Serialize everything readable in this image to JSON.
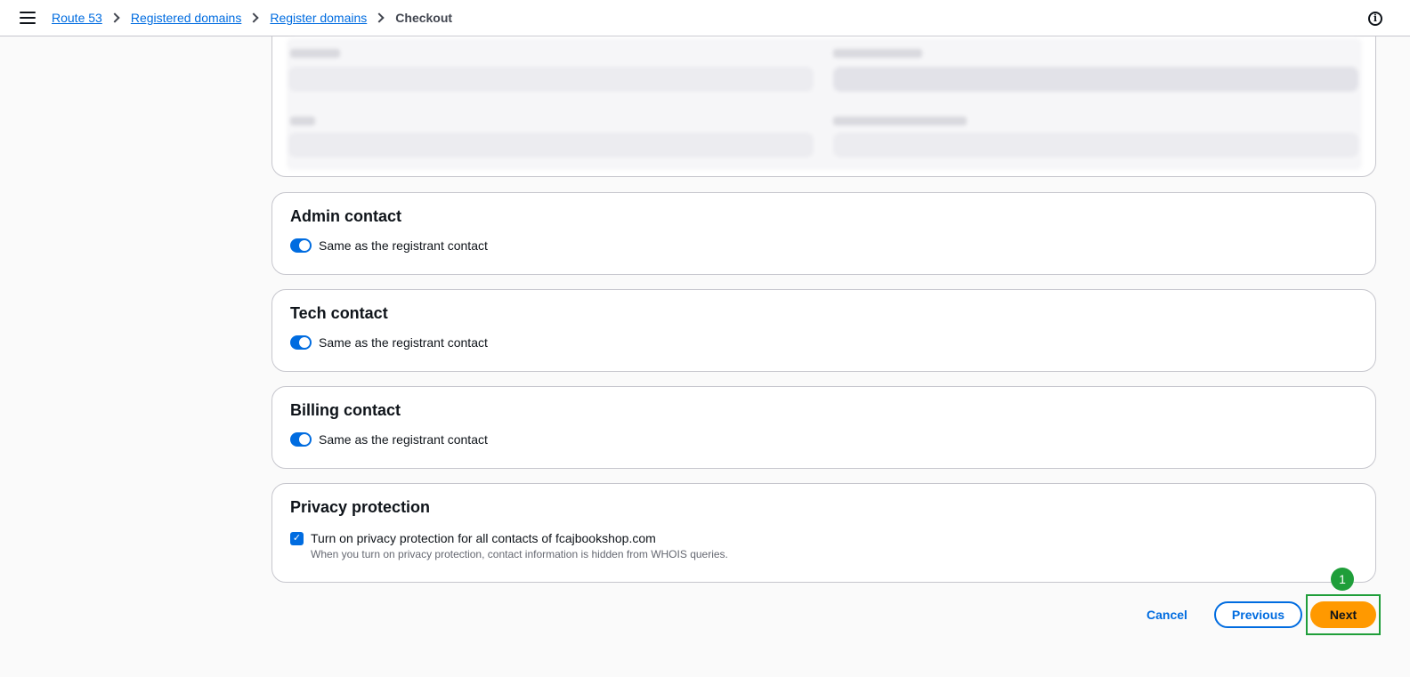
{
  "breadcrumb": {
    "items": [
      "Route 53",
      "Registered domains",
      "Register domains"
    ],
    "current": "Checkout"
  },
  "icons": {
    "menu": "hamburger-menu-icon",
    "info": "info-icon",
    "info_glyph": "i",
    "check_glyph": "✓"
  },
  "contacts": {
    "admin": {
      "title": "Admin contact",
      "toggle_label": "Same as the registrant contact",
      "toggle_on": true
    },
    "tech": {
      "title": "Tech contact",
      "toggle_label": "Same as the registrant contact",
      "toggle_on": true
    },
    "billing": {
      "title": "Billing contact",
      "toggle_label": "Same as the registrant contact",
      "toggle_on": true
    }
  },
  "privacy": {
    "title": "Privacy protection",
    "checkbox_label": "Turn on privacy protection for all contacts of fcajbookshop.com",
    "description": "When you turn on privacy protection, contact information is hidden from WHOIS queries.",
    "checked": true
  },
  "actions": {
    "cancel": "Cancel",
    "previous": "Previous",
    "next": "Next"
  },
  "annotation": {
    "step": "1"
  },
  "colors": {
    "link": "#006ce0",
    "primary_button": "#ff9900",
    "highlight": "#1f9e3a"
  }
}
